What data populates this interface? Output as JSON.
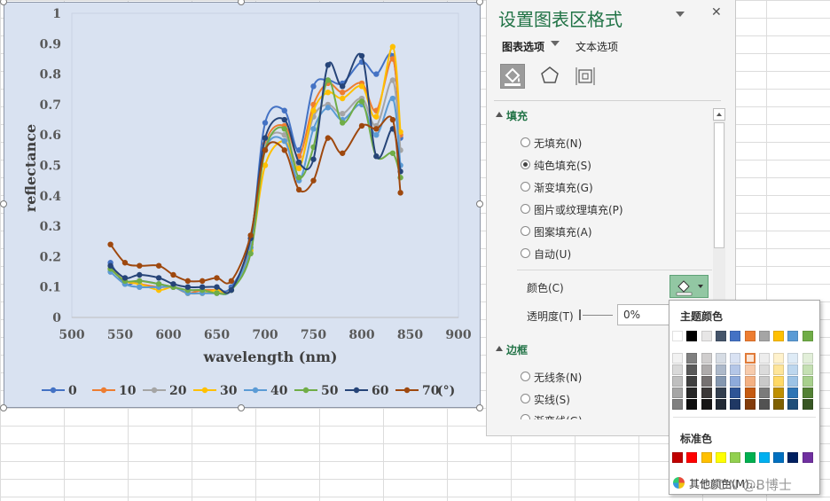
{
  "chart_data": {
    "type": "line",
    "xlabel": "wavelength (nm)",
    "ylabel": "reflectance",
    "xlim": [
      500,
      900
    ],
    "ylim": [
      0,
      1
    ],
    "xticks": [
      "500",
      "550",
      "600",
      "650",
      "700",
      "750",
      "800",
      "850",
      "900"
    ],
    "yticks": [
      "0",
      "0.1",
      "0.2",
      "0.3",
      "0.4",
      "0.5",
      "0.6",
      "0.7",
      "0.8",
      "0.9",
      "1"
    ],
    "grid": false,
    "legend_position": "bottom",
    "legend_suffix": "(°)",
    "x": [
      540,
      555,
      570,
      590,
      605,
      620,
      635,
      650,
      665,
      685,
      700,
      720,
      735,
      750,
      765,
      780,
      800,
      815,
      832,
      840
    ],
    "series": [
      {
        "name": "0",
        "color": "#4472c4",
        "values": [
          0.18,
          0.11,
          0.12,
          0.11,
          0.1,
          0.09,
          0.09,
          0.09,
          0.1,
          0.25,
          0.64,
          0.68,
          0.55,
          0.76,
          0.78,
          0.77,
          0.84,
          0.8,
          0.86,
          0.59
        ]
      },
      {
        "name": "10",
        "color": "#ed7d31",
        "values": [
          0.16,
          0.12,
          0.11,
          0.1,
          0.1,
          0.08,
          0.09,
          0.09,
          0.09,
          0.24,
          0.57,
          0.63,
          0.53,
          0.7,
          0.77,
          0.74,
          0.77,
          0.68,
          0.85,
          0.6
        ]
      },
      {
        "name": "20",
        "color": "#a5a5a5",
        "values": [
          0.15,
          0.11,
          0.1,
          0.1,
          0.1,
          0.08,
          0.08,
          0.08,
          0.09,
          0.23,
          0.56,
          0.6,
          0.5,
          0.66,
          0.7,
          0.67,
          0.72,
          0.63,
          0.78,
          0.55
        ]
      },
      {
        "name": "30",
        "color": "#ffc000",
        "values": [
          0.16,
          0.12,
          0.11,
          0.09,
          0.1,
          0.08,
          0.08,
          0.09,
          0.09,
          0.22,
          0.5,
          0.58,
          0.49,
          0.68,
          0.74,
          0.72,
          0.76,
          0.66,
          0.89,
          0.61
        ]
      },
      {
        "name": "40",
        "color": "#5b9bd5",
        "values": [
          0.15,
          0.11,
          0.1,
          0.1,
          0.1,
          0.08,
          0.08,
          0.08,
          0.09,
          0.23,
          0.55,
          0.58,
          0.45,
          0.62,
          0.69,
          0.65,
          0.7,
          0.6,
          0.72,
          0.5
        ]
      },
      {
        "name": "50",
        "color": "#70ad47",
        "values": [
          0.16,
          0.12,
          0.12,
          0.11,
          0.1,
          0.09,
          0.09,
          0.08,
          0.09,
          0.21,
          0.55,
          0.62,
          0.46,
          0.56,
          0.78,
          0.64,
          0.71,
          0.53,
          0.54,
          0.46
        ]
      },
      {
        "name": "60",
        "color": "#264478",
        "values": [
          0.17,
          0.13,
          0.14,
          0.13,
          0.11,
          0.1,
          0.1,
          0.1,
          0.09,
          0.26,
          0.59,
          0.65,
          0.51,
          0.52,
          0.83,
          0.76,
          0.86,
          0.53,
          0.62,
          0.48
        ]
      },
      {
        "name": "70",
        "color": "#9e480e",
        "values": [
          0.24,
          0.18,
          0.17,
          0.17,
          0.14,
          0.12,
          0.12,
          0.13,
          0.12,
          0.27,
          0.55,
          0.55,
          0.42,
          0.45,
          0.59,
          0.54,
          0.63,
          0.62,
          0.65,
          0.41
        ]
      }
    ]
  },
  "panel": {
    "title": "设置图表区格式",
    "dropdown_icon": "triangle-down-icon",
    "close_label": "✕",
    "tab_chart_options": "图表选项",
    "tab_text_options": "文本选项",
    "section_fill": "填充",
    "fill_options": [
      "无填充(N)",
      "纯色填充(S)",
      "渐变填充(G)",
      "图片或纹理填充(P)",
      "图案填充(A)",
      "自动(U)"
    ],
    "fill_selected": 1,
    "color_label": "颜色(C)",
    "transparency_label": "透明度(T)",
    "transparency_value": "0%",
    "section_border": "边框",
    "border_options": [
      "无线条(N)",
      "实线(S)",
      "渐变线(G)"
    ]
  },
  "picker": {
    "theme_colors_label": "主题颜色",
    "standard_colors_label": "标准色",
    "more_colors_label": "其他颜色(M)...",
    "theme_top": [
      "#ffffff",
      "#000000",
      "#e7e6e6",
      "#44546a",
      "#4472c4",
      "#ed7d31",
      "#a5a5a5",
      "#ffc000",
      "#5b9bd5",
      "#70ad47"
    ],
    "theme_shades": [
      [
        "#f2f2f2",
        "#d9d9d9",
        "#bfbfbf",
        "#a6a6a6",
        "#808080"
      ],
      [
        "#808080",
        "#595959",
        "#404040",
        "#262626",
        "#0d0d0d"
      ],
      [
        "#d0cece",
        "#aeabab",
        "#757171",
        "#3b3838",
        "#171616"
      ],
      [
        "#d6dce4",
        "#adb9ca",
        "#8497b0",
        "#333f4f",
        "#222a35"
      ],
      [
        "#d9e2f3",
        "#b4c6e7",
        "#8eaadb",
        "#2f5496",
        "#1f3864"
      ],
      [
        "#fbe5d5",
        "#f7cbac",
        "#f4b183",
        "#c55a11",
        "#833c0b"
      ],
      [
        "#ededed",
        "#dbdbdb",
        "#c9c9c9",
        "#7b7b7b",
        "#525252"
      ],
      [
        "#fff2cc",
        "#fee599",
        "#ffd966",
        "#bf8f00",
        "#7f6000"
      ],
      [
        "#deebf6",
        "#bdd7ee",
        "#9cc3e5",
        "#2e75b5",
        "#1e4e79"
      ],
      [
        "#e2efd9",
        "#c5e0b3",
        "#a8d08d",
        "#538135",
        "#375623"
      ]
    ],
    "standard": [
      "#c00000",
      "#ff0000",
      "#ffc000",
      "#ffff00",
      "#92d050",
      "#00b050",
      "#00b0f0",
      "#0070c0",
      "#002060",
      "#7030a0"
    ]
  },
  "watermark": "CSDN @B博士"
}
